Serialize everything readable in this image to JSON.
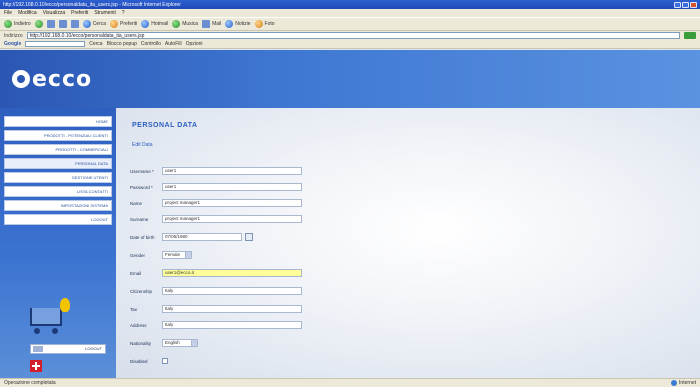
{
  "window": {
    "title": "http://192.168.0.10/ecco/personaldata_ita_users.jsp - Microsoft Internet Explorer"
  },
  "menubar": [
    "File",
    "Modifica",
    "Visualizza",
    "Preferiti",
    "Strumenti",
    "?"
  ],
  "toolbar": {
    "back": "Indietro",
    "search": "Cerca",
    "favorites": "Preferiti",
    "items": [
      "Hotmail",
      "Musica",
      "Mail",
      "Notizie",
      "Foto"
    ]
  },
  "address": {
    "label": "Indirizzo",
    "url": "http://192.168.0.10/ecco/personaldata_ita_users.jsp"
  },
  "googlebar": {
    "label": "Google",
    "items": [
      "Cerca",
      "Blocco popup",
      "Controllo",
      "AutoFill",
      "Opzioni"
    ]
  },
  "logo": "ecco",
  "sidebar": {
    "items": [
      "Home",
      "Prodotti - Potenziali Clienti",
      "Prodotti - Commerciali",
      "Personal Data",
      "Gestione Utenti",
      "Lista Contatti",
      "Impostazioni Sistema",
      "Logout"
    ],
    "badge": "LOGOUT"
  },
  "content": {
    "title": "PERSONAL DATA",
    "sub_link": "Edit Data"
  },
  "form": {
    "fields": [
      {
        "label": "Username *",
        "value": "user1",
        "type": "text"
      },
      {
        "label": "Password *",
        "value": "user1",
        "type": "text"
      },
      {
        "label": "Name",
        "value": "project manager1",
        "type": "text"
      },
      {
        "label": "Surname",
        "value": "project manager1",
        "type": "text"
      },
      {
        "label": "Date of birth",
        "value": "07/05/1980",
        "type": "date"
      },
      {
        "label": "Gender",
        "value": "Female",
        "type": "select"
      },
      {
        "label": "Email",
        "value": "user1@ecco.it",
        "type": "text",
        "highlight": true
      },
      {
        "label": "Citizenship",
        "value": "Italy",
        "type": "text"
      },
      {
        "label": "Tax",
        "value": "Italy",
        "type": "text"
      },
      {
        "label": "Address",
        "value": "Italy",
        "type": "text"
      },
      {
        "label": "Nationality",
        "value": "English",
        "type": "select"
      },
      {
        "label": "Disabled",
        "value": "",
        "type": "checkbox"
      }
    ]
  },
  "status": {
    "left": "Operazione completata",
    "right": "Internet"
  }
}
